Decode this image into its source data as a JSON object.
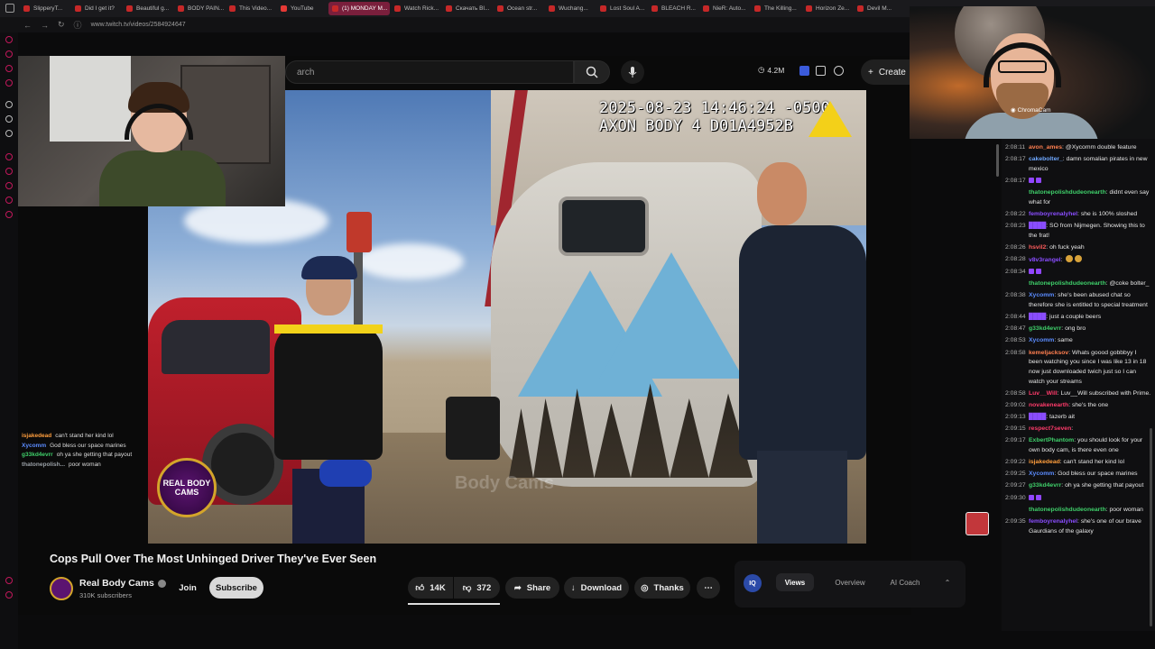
{
  "browser": {
    "tabs": [
      {
        "label": "SlipperyT..."
      },
      {
        "label": "Did I get it?"
      },
      {
        "label": "Beautiful g..."
      },
      {
        "label": "BODY PAIN..."
      },
      {
        "label": "This Video..."
      },
      {
        "label": "YouTube"
      },
      {
        "label": "(1) MONDAY M...",
        "active": true
      },
      {
        "label": "Watch Rick..."
      },
      {
        "label": "Скачать Bl..."
      },
      {
        "label": "Ocean str..."
      },
      {
        "label": "Wuchang..."
      },
      {
        "label": "Lost Soul A..."
      },
      {
        "label": "BLEACH R..."
      },
      {
        "label": "NieR: Auto..."
      },
      {
        "label": "The Killing..."
      },
      {
        "label": "Horizon Ze..."
      },
      {
        "label": "Devil M..."
      }
    ],
    "url": "www.twitch.tv/videos/2584924647"
  },
  "youtube": {
    "search_placeholder": "arch",
    "views_stat": "4.2M",
    "create_label": "Create"
  },
  "video": {
    "timestamp_line1": "2025-08-23 14:46:24 -0500",
    "timestamp_line2": "AXON BODY 4 D01A4952B",
    "logo_text": "REAL BODY CAMS",
    "watermark": "Body Cams"
  },
  "overlay_chat": [
    {
      "user": "isjakedead",
      "text": "can't stand her kind lol",
      "color": "#ff9e3d"
    },
    {
      "user": "Xycomm",
      "text": "God bless our space marines",
      "color": "#5b8cff"
    },
    {
      "user": "g33kd4evrr",
      "text": "oh ya she getting that payout",
      "color": "#3fcf6a"
    },
    {
      "user": "thatonepolish...",
      "text": "poor woman",
      "color": "#9aa0a6"
    }
  ],
  "yt_video": {
    "title": "Cops Pull Over The Most Unhinged Driver They've Ever Seen",
    "channel": "Real Body Cams",
    "subscribers": "310K subscribers",
    "join_label": "Join",
    "subscribe_label": "Subscribe",
    "likes": "14K",
    "dislikes": "372",
    "share_label": "Share",
    "download_label": "Download",
    "thanks_label": "Thanks"
  },
  "iq_panel": {
    "logo": "IQ",
    "tabs": [
      {
        "label": "Views",
        "active": true
      },
      {
        "label": "Overview"
      },
      {
        "label": "AI Coach"
      }
    ]
  },
  "webcam_right": {
    "label": "ChromaCam"
  },
  "chat": [
    {
      "ts": "2:08:11",
      "user": "avon_ames",
      "color": "#ff7f50",
      "text": "@Xycomm double feature"
    },
    {
      "ts": "2:08:17",
      "user": "cakebolter_",
      "color": "#6fa8ff",
      "text": "damn somalian pirates in new mexico"
    },
    {
      "ts": "2:08:17",
      "user": "",
      "color": "#ffffff",
      "text": "",
      "badges": true
    },
    {
      "ts": "",
      "user": "thatonepolishdudeonearth",
      "color": "#3fcf6a",
      "text": "didnt even say what for"
    },
    {
      "ts": "2:08:22",
      "user": "femboyrenalyhel",
      "color": "#8a4dff",
      "text": "she is 100% sloshed"
    },
    {
      "ts": "2:08:23",
      "user": "",
      "color": "#8a4dff",
      "text": "SO from Nijmegen. Showing this to the frat!",
      "hidden_name": true
    },
    {
      "ts": "2:08:26",
      "user": "hsvil2",
      "color": "#ff5c5c",
      "text": "oh fuck yeah"
    },
    {
      "ts": "2:08:28",
      "user": "v8v3rangel",
      "color": "#8a4dff",
      "text": "",
      "emotes": true
    },
    {
      "ts": "2:08:34",
      "user": "",
      "color": "#ffffff",
      "text": "",
      "badges": true
    },
    {
      "ts": "",
      "user": "thatonepolishdudeonearth",
      "color": "#3fcf6a",
      "text": "@coke bolter_"
    },
    {
      "ts": "2:08:38",
      "user": "Xycomm",
      "color": "#5b8cff",
      "text": "she's been abused chat so therefore she is entitled to special treatment"
    },
    {
      "ts": "2:08:44",
      "user": "",
      "color": "#8a4dff",
      "text": "just a couple beers",
      "hidden_name": true
    },
    {
      "ts": "2:08:47",
      "user": "g33kd4evrr",
      "color": "#3fcf6a",
      "text": "ong bro"
    },
    {
      "ts": "2:08:53",
      "user": "Xycomm",
      "color": "#5b8cff",
      "text": "same"
    },
    {
      "ts": "2:08:58",
      "user": "kemeljacksov",
      "color": "#ff7f50",
      "text": "Whats goood gobbbyy I been watching you since I was like 13 in 18 now just downloaded twich just so I can watch your streams"
    },
    {
      "ts": "2:08:58",
      "user": "Luv__Will",
      "color": "#ff3b6b",
      "text": "Luv__Will subscribed with Prime."
    },
    {
      "ts": "2:09:02",
      "user": "novakenearth",
      "color": "#ff3b6b",
      "text": "she's the one"
    },
    {
      "ts": "2:09:13",
      "user": "",
      "color": "#8a4dff",
      "text": "tazerb ait",
      "hidden_name": true
    },
    {
      "ts": "2:09:15",
      "user": "respect7seven",
      "color": "#ff3b6b",
      "text": ""
    },
    {
      "ts": "2:09:17",
      "user": "ExbertPhantom",
      "color": "#3fcf6a",
      "text": "you should look for your own body cam, is there even one"
    },
    {
      "ts": "2:09:22",
      "user": "isjakedead",
      "color": "#ff9e3d",
      "text": "can't stand her kind lol"
    },
    {
      "ts": "2:09:25",
      "user": "Xycomm",
      "color": "#5b8cff",
      "text": "God bless our space marines"
    },
    {
      "ts": "2:09:27",
      "user": "g33kd4evrr",
      "color": "#3fcf6a",
      "text": "oh ya she getting that payout"
    },
    {
      "ts": "2:09:30",
      "user": "",
      "color": "#ffffff",
      "text": "",
      "badges": true
    },
    {
      "ts": "",
      "user": "thatonepolishdudeonearth",
      "color": "#3fcf6a",
      "text": "poor woman"
    },
    {
      "ts": "2:09:35",
      "user": "femboyrenalyhel",
      "color": "#8a4dff",
      "text": "she's one of our brave Gaurdians of the galaxy"
    }
  ]
}
